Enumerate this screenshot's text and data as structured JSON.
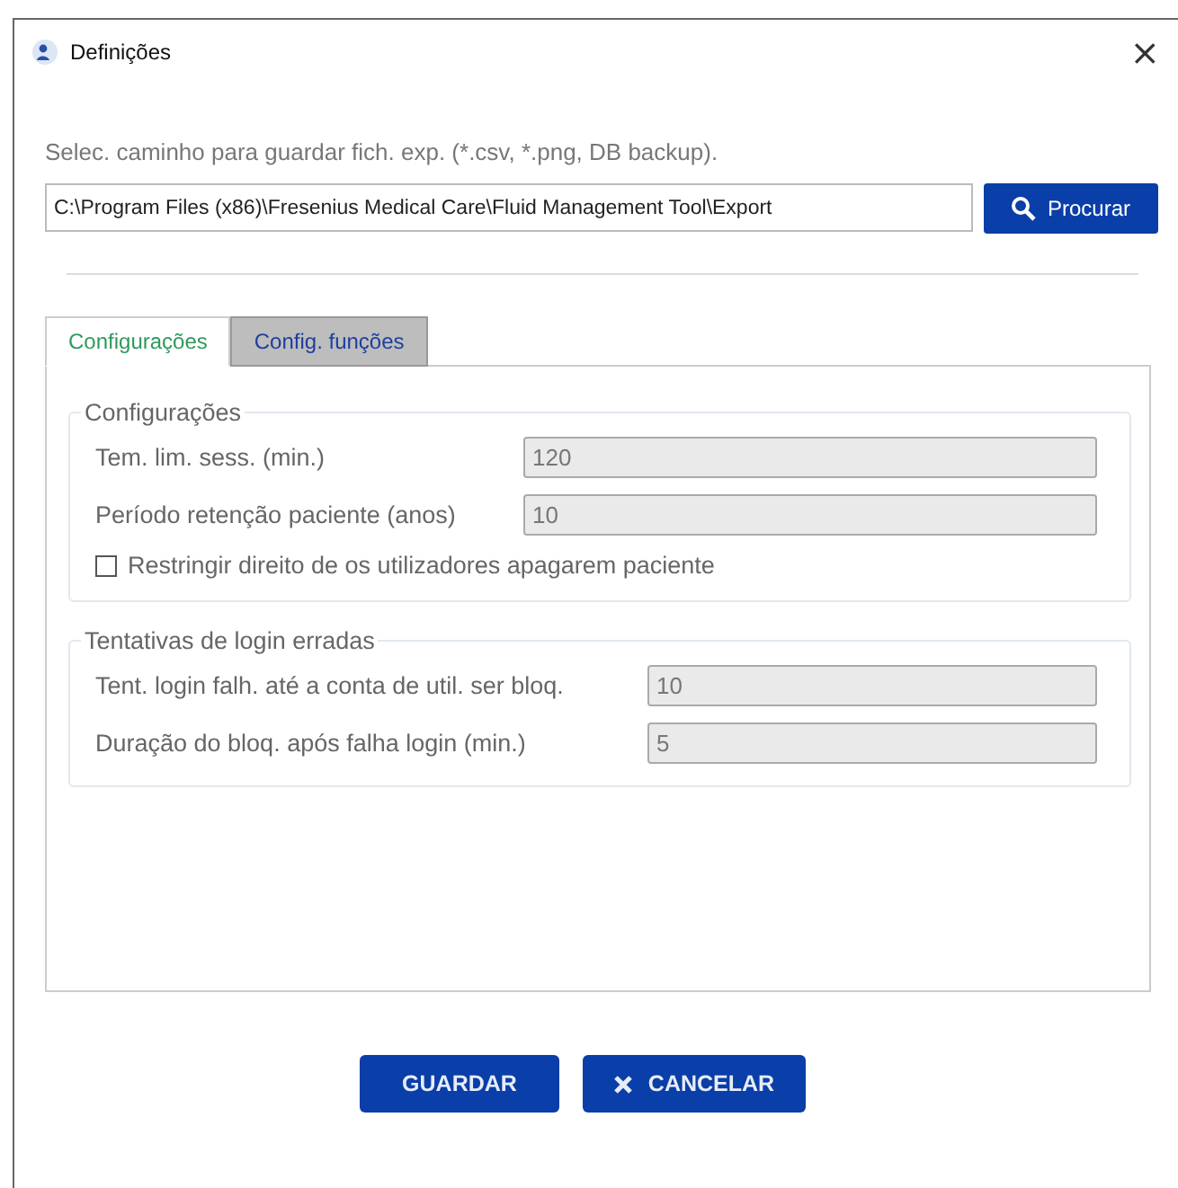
{
  "window": {
    "title": "Definições",
    "close": "×"
  },
  "export": {
    "label": "Selec. caminho para guardar fich. exp. (*.csv, *.png, DB backup).",
    "path": "C:\\Program Files (x86)\\Fresenius Medical Care\\Fluid Management Tool\\Export",
    "browse": "Procurar"
  },
  "tabs": [
    {
      "label": "Configurações",
      "selected": true
    },
    {
      "label": "Config. funções",
      "selected": false
    }
  ],
  "groups": [
    {
      "title": "Configurações",
      "rows": [
        {
          "kind": "field",
          "label": "Tem. lim. sess. (min.)",
          "value": "120"
        },
        {
          "kind": "field",
          "label": "Período retenção paciente (anos)",
          "value": "10"
        },
        {
          "kind": "checkbox",
          "label": "Restringir direito de os utilizadores apagarem paciente",
          "checked": false
        }
      ]
    },
    {
      "title": "Tentativas de login erradas",
      "rows": [
        {
          "kind": "field",
          "label": "Tent. login falh. até a conta de util. ser bloq.",
          "value": "10"
        },
        {
          "kind": "field",
          "label": "Duração do bloq. após falha login (min.)",
          "value": "5"
        }
      ]
    }
  ],
  "buttons": [
    {
      "kind": "save",
      "label": "GUARDAR"
    },
    {
      "kind": "cancel",
      "label": "CANCELAR"
    }
  ]
}
